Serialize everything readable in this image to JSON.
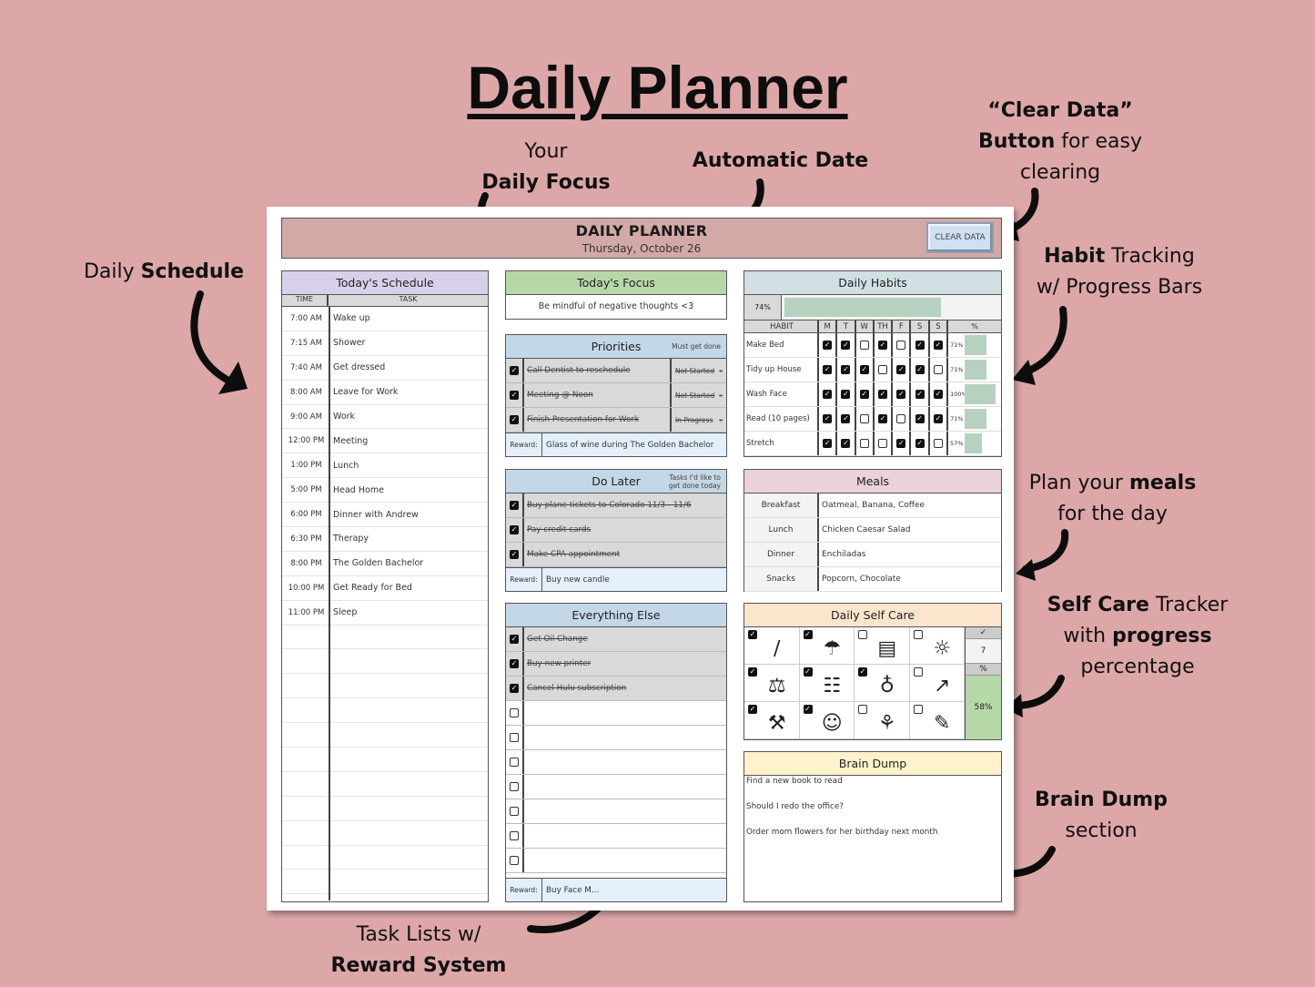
{
  "promo": {
    "title": "Daily Planner",
    "notes": {
      "focus_1": "Your",
      "focus_2": "Daily Focus",
      "date": "Automatic Date",
      "clear_1": "“Clear Data”",
      "clear_2b": "Button",
      "clear_2": " for easy",
      "clear_3": "clearing",
      "schedule_1": "Daily ",
      "schedule_2": "Schedule",
      "habit_1b": "Habit",
      "habit_1": " Tracking",
      "habit_2": "w/ Progress Bars",
      "meals_1": "Plan your ",
      "meals_1b": "meals",
      "meals_2": "for the day",
      "self_1b": "Self Care",
      "self_1": " Tracker",
      "self_2": "with ",
      "self_2b": "progress",
      "self_3": "percentage",
      "dump_1": "Brain Dump",
      "dump_2": "section",
      "tasks_1": "Task Lists w/",
      "tasks_2": "Reward System"
    }
  },
  "header": {
    "title": "DAILY PLANNER",
    "date": "Thursday, October 26",
    "clear_button": "CLEAR DATA"
  },
  "schedule": {
    "title": "Today's Schedule",
    "col_time": "TIME",
    "col_task": "TASK",
    "rows": [
      {
        "time": "7:00 AM",
        "task": "Wake up"
      },
      {
        "time": "7:15 AM",
        "task": "Shower"
      },
      {
        "time": "7:40 AM",
        "task": "Get dressed"
      },
      {
        "time": "8:00 AM",
        "task": "Leave for Work"
      },
      {
        "time": "9:00 AM",
        "task": "Work"
      },
      {
        "time": "12:00 PM",
        "task": "Meeting"
      },
      {
        "time": "1:00 PM",
        "task": "Lunch"
      },
      {
        "time": "5:00 PM",
        "task": "Head Home"
      },
      {
        "time": "6:00 PM",
        "task": "Dinner with Andrew"
      },
      {
        "time": "6:30 PM",
        "task": "Therapy"
      },
      {
        "time": "8:00 PM",
        "task": "The Golden Bachelor"
      },
      {
        "time": "10:00 PM",
        "task": "Get Ready for Bed"
      },
      {
        "time": "11:00 PM",
        "task": "Sleep"
      },
      {
        "time": "",
        "task": ""
      },
      {
        "time": "",
        "task": ""
      },
      {
        "time": "",
        "task": ""
      },
      {
        "time": "",
        "task": ""
      },
      {
        "time": "",
        "task": ""
      },
      {
        "time": "",
        "task": ""
      },
      {
        "time": "",
        "task": ""
      },
      {
        "time": "",
        "task": ""
      },
      {
        "time": "",
        "task": ""
      },
      {
        "time": "",
        "task": ""
      },
      {
        "time": "",
        "task": ""
      }
    ]
  },
  "focus": {
    "title": "Today's Focus",
    "text": "Be mindful of negative thoughts <3"
  },
  "priorities": {
    "title": "Priorities",
    "subtitle": "Must get done",
    "items": [
      {
        "checked": true,
        "text": "Call Dentist to reschedule",
        "status": "Not Started"
      },
      {
        "checked": true,
        "text": "Meeting @ Noon",
        "status": "Not Started"
      },
      {
        "checked": true,
        "text": "Finish Presentation for Work",
        "status": "In Progress"
      }
    ],
    "reward_label": "Reward:",
    "reward": "Glass of wine during The Golden Bachelor"
  },
  "do_later": {
    "title": "Do Later",
    "subtitle": "Tasks I'd like to get done today",
    "items": [
      {
        "checked": true,
        "text": "Buy plane tickets to Colorado 11/3 - 11/6"
      },
      {
        "checked": true,
        "text": "Pay credit cards"
      },
      {
        "checked": true,
        "text": "Make CPA appointment"
      }
    ],
    "reward_label": "Reward:",
    "reward": "Buy new candle"
  },
  "everything_else": {
    "title": "Everything Else",
    "items": [
      {
        "checked": true,
        "text": "Get Oil Change"
      },
      {
        "checked": true,
        "text": "Buy new printer"
      },
      {
        "checked": true,
        "text": "Cancel Hulu subscription"
      },
      {
        "checked": false,
        "text": ""
      },
      {
        "checked": false,
        "text": ""
      },
      {
        "checked": false,
        "text": ""
      },
      {
        "checked": false,
        "text": ""
      },
      {
        "checked": false,
        "text": ""
      },
      {
        "checked": false,
        "text": ""
      },
      {
        "checked": false,
        "text": ""
      }
    ],
    "reward_label": "Reward:",
    "reward": "Buy Face M..."
  },
  "habits": {
    "title": "Daily Habits",
    "overall_label": "74%",
    "overall_value": 0.74,
    "col_habit": "HABIT",
    "days": [
      "M",
      "T",
      "W",
      "TH",
      "F",
      "S",
      "S"
    ],
    "col_pct": "%",
    "rows": [
      {
        "name": "Make Bed",
        "checks": [
          true,
          true,
          false,
          true,
          false,
          true,
          true
        ],
        "pct_label": "71%",
        "pct": 0.71
      },
      {
        "name": "Tidy up House",
        "checks": [
          true,
          true,
          true,
          false,
          true,
          true,
          false
        ],
        "pct_label": "71%",
        "pct": 0.71
      },
      {
        "name": "Wash Face",
        "checks": [
          true,
          true,
          true,
          true,
          true,
          true,
          true
        ],
        "pct_label": "100%",
        "pct": 1.0
      },
      {
        "name": "Read (10 pages)",
        "checks": [
          true,
          true,
          false,
          true,
          false,
          true,
          true
        ],
        "pct_label": "71%",
        "pct": 0.71
      },
      {
        "name": "Stretch",
        "checks": [
          true,
          true,
          false,
          false,
          true,
          true,
          false
        ],
        "pct_label": "57%",
        "pct": 0.57
      }
    ]
  },
  "meals": {
    "title": "Meals",
    "rows": [
      {
        "meal": "Breakfast",
        "food": "Oatmeal, Banana, Coffee"
      },
      {
        "meal": "Lunch",
        "food": "Chicken Caesar Salad"
      },
      {
        "meal": "Dinner",
        "food": "Enchiladas"
      },
      {
        "meal": "Snacks",
        "food": "Popcorn, Chocolate"
      }
    ]
  },
  "self_care": {
    "title": "Daily Self Care",
    "items": [
      {
        "icon": "toothbrush-icon",
        "glyph": "∕",
        "checked": true
      },
      {
        "icon": "shower-icon",
        "glyph": "☂",
        "checked": true
      },
      {
        "icon": "vitamins-icon",
        "glyph": "▤",
        "checked": false
      },
      {
        "icon": "sun-icon",
        "glyph": "☼",
        "checked": false
      },
      {
        "icon": "dumbbell-icon",
        "glyph": "⚖",
        "checked": true
      },
      {
        "icon": "book-icon",
        "glyph": "☷",
        "checked": true
      },
      {
        "icon": "water-bottle-icon",
        "glyph": "♁",
        "checked": true
      },
      {
        "icon": "sneakers-icon",
        "glyph": "↗",
        "checked": false
      },
      {
        "icon": "cleaning-icon",
        "glyph": "⚒",
        "checked": true
      },
      {
        "icon": "meditation-icon",
        "glyph": "☺",
        "checked": true
      },
      {
        "icon": "healthy-food-icon",
        "glyph": "⚘",
        "checked": false
      },
      {
        "icon": "journal-icon",
        "glyph": "✎",
        "checked": false
      }
    ],
    "count_header": "✓",
    "count": "7",
    "pct_header": "%",
    "pct": "58%"
  },
  "brain_dump": {
    "title": "Brain Dump",
    "lines": [
      "Find a new book to read",
      "Should I redo the office?",
      "Order mom flowers for her birthday next month"
    ]
  }
}
